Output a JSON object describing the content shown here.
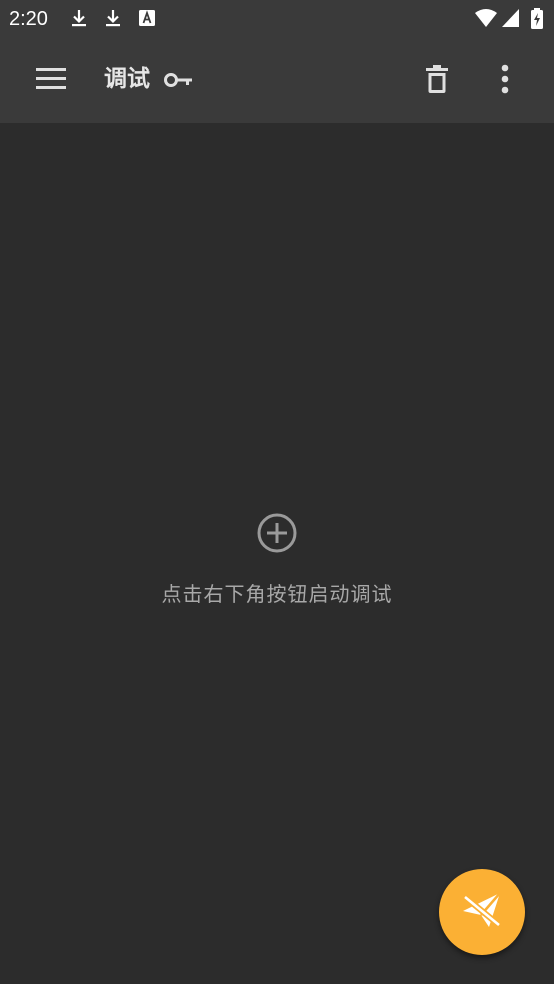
{
  "status_bar": {
    "time": "2:20",
    "icons": [
      "download-icon",
      "download-icon",
      "font-a-icon",
      "wifi-icon",
      "signal-icon",
      "battery-charging-icon"
    ]
  },
  "app_bar": {
    "title": "调试",
    "title_icon": "key-icon",
    "nav_icon": "menu-icon",
    "actions": [
      "delete-icon",
      "more-vert-icon"
    ]
  },
  "empty_state": {
    "icon": "add-circle-icon",
    "message": "点击右下角按钮启动调试"
  },
  "fab": {
    "icon": "send-off-icon",
    "color": "#fbb034"
  },
  "colors": {
    "background": "#2c2c2c",
    "bar": "#3a3a3a",
    "accent": "#fbb034"
  }
}
